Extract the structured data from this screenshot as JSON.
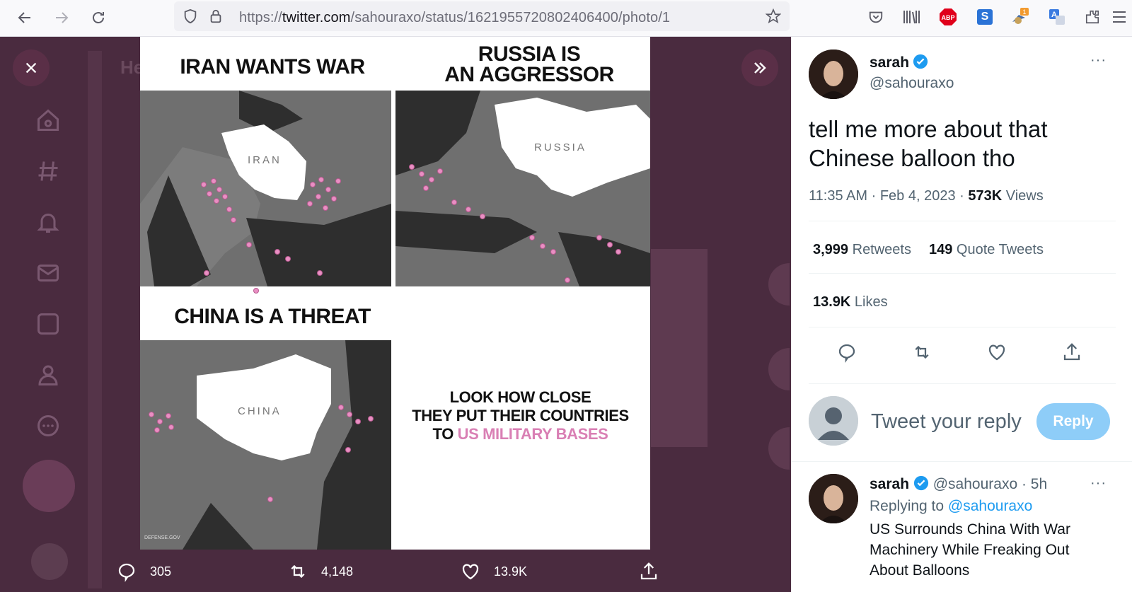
{
  "browser": {
    "url_prefix": "https://",
    "url_domain": "twitter.com",
    "url_path": "/sahouraxo/status/1621955720802406400/photo/1",
    "extensions": [
      "pocket-icon",
      "library-icon",
      "adblock-icon",
      "skype-icon",
      "notifier-icon",
      "translate-icon",
      "extensions-icon",
      "menu-icon"
    ],
    "adblock_label": "ABP",
    "notifier_badge": "1"
  },
  "photo": {
    "panel1_title": "IRAN WANTS WAR",
    "panel1_map_label": "IRAN",
    "panel2_title_line1": "RUSSIA IS",
    "panel2_title_line2": "AN AGGRESSOR",
    "panel2_map_label": "RUSSIA",
    "panel3_title": "CHINA IS A THREAT",
    "panel3_map_label": "CHINA",
    "panel3_source": "DEFENSE.GOV",
    "look_line1": "LOOK HOW CLOSE",
    "look_line2": "THEY PUT THEIR COUNTRIES",
    "look_line3_a": "TO ",
    "look_line3_b": "US MILITARY BASES"
  },
  "photo_actions": {
    "replies": "305",
    "retweets": "4,148",
    "likes": "13.9K"
  },
  "tweet": {
    "author_name": "sarah",
    "author_handle": "@sahouraxo",
    "text_line1": "tell me more about that",
    "text_line2": "Chinese balloon tho",
    "time": "11:35 AM",
    "sep1": " · ",
    "date": "Feb 4, 2023",
    "sep2": " · ",
    "views_count": "573K",
    "views_label": " Views",
    "retweets_count": "3,999",
    "retweets_label": " Retweets",
    "quotes_count": "149",
    "quotes_label": " Quote Tweets",
    "likes_count": "13.9K",
    "likes_label": " Likes",
    "more": "···"
  },
  "reply_box": {
    "placeholder": "Tweet your reply",
    "button": "Reply"
  },
  "reply_tweet": {
    "author_name": "sarah",
    "author_handle": "@sahouraxo",
    "age": " · 5h",
    "replying_to_label": "Replying to ",
    "replying_to_handle": "@sahouraxo",
    "text_line1": "US Surrounds China With War",
    "text_line2": "Machinery While Freaking Out",
    "text_line3": "About Balloons",
    "more": "···"
  },
  "colors": {
    "accent": "#1d9bf0",
    "overlay": "#4a2b3f",
    "base_dot": "#e98fc3",
    "reply_button": "#8ecdf8"
  }
}
